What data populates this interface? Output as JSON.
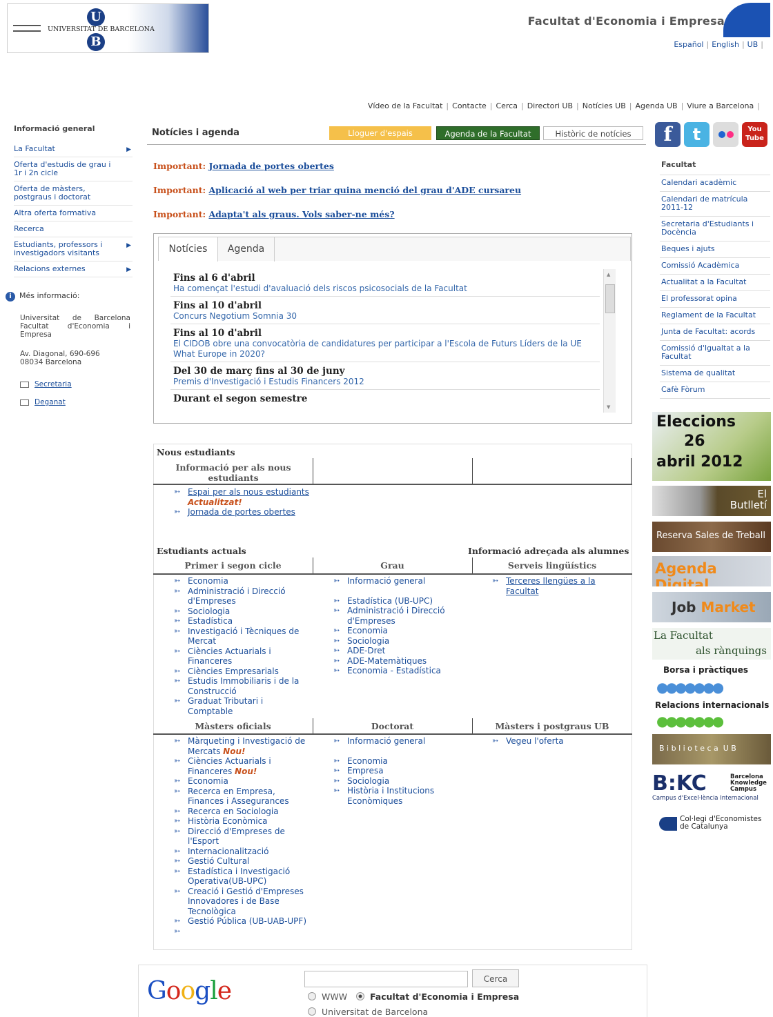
{
  "header": {
    "university": "UNIVERSITAT DE BARCELONA",
    "faculty_title": "Facultat d'Economia i Empresa",
    "languages": [
      "Español",
      "English",
      "UB"
    ],
    "topnav": [
      "Vídeo de la Facultat",
      "Contacte",
      "Cerca",
      "Directori UB",
      "Notícies UB",
      "Agenda UB",
      "Viure a Barcelona"
    ]
  },
  "left": {
    "title": "Informació general",
    "items": [
      {
        "label": "La Facultat",
        "arrow": true
      },
      {
        "label": "Oferta d'estudis de grau i 1r i 2n cicle",
        "arrow": false
      },
      {
        "label": "Oferta de màsters, postgraus i doctorat",
        "arrow": false
      },
      {
        "label": "Altra oferta formativa",
        "arrow": false
      },
      {
        "label": "Recerca",
        "arrow": false
      },
      {
        "label": "Estudiants, professors i investigadors visitants",
        "arrow": true
      },
      {
        "label": "Relacions externes",
        "arrow": true
      }
    ],
    "mes_info": "Més informació:",
    "address_1": "Universitat de Barcelona Facultat d'Economia i Empresa",
    "address_2": "Av. Diagonal, 690-696 08034 Barcelona",
    "mail_1": "Secretaria",
    "mail_2": "Deganat"
  },
  "center": {
    "title": "Notícies i agenda",
    "btn_lloguer": "Lloguer d'espais",
    "btn_agenda": "Agenda de la Facultat",
    "btn_historic": "Històric de notícies",
    "important_label": "Important:",
    "important": [
      "Jornada de portes obertes",
      "Aplicació al web per triar quina menció del grau d'ADE cursareu",
      "Adapta't als graus. Vols saber-ne més?"
    ],
    "tabs": [
      "Notícies",
      "Agenda"
    ],
    "news": [
      {
        "title": "Fins al 6 d'abril",
        "text": "Ha començat l'estudi d'avaluació dels riscos psicosocials de la Facultat"
      },
      {
        "title": "Fins al 10 d'abril",
        "text": "Concurs Negotium Somnia 30"
      },
      {
        "title": "Fins al 10 d'abril",
        "text": "El CIDOB obre una convocatòria de candidatures per participar a l'Escola de Futurs Líders de la UE What Europe in 2020?"
      },
      {
        "title": "Del 30 de març fins al 30 de juny",
        "text": "Premis d'Investigació i Estudis Financers 2012"
      },
      {
        "title": "Durant el segon semestre",
        "text": ""
      }
    ]
  },
  "students": {
    "nous_title": "Nous estudiants",
    "nous_col": "Informació per als nous estudiants",
    "nous_links": [
      "Espai per als nous estudiants",
      "Jornada de portes obertes"
    ],
    "actualitzat": "Actualitzat!",
    "actuals_title": "Estudiants actuals",
    "alumnes_title": "Informació adreçada als alumnes",
    "col_primer": "Primer i segon cicle",
    "col_grau": "Grau",
    "col_serveis": "Serveis lingüístics",
    "primer_links": [
      "Economia",
      "Administració i Direcció d'Empreses",
      "Sociologia",
      "Estadística",
      "Investigació i Tècniques de Mercat",
      "Ciències Actuarials i Financeres",
      "Ciències Empresarials",
      "Estudis Immobiliaris i de la Construcció",
      "Graduat Tributari i Comptable"
    ],
    "grau_links": [
      "Informació general",
      "Estadística (UB-UPC)",
      "Administració i Direcció d'Empreses",
      "Economia",
      "Sociologia",
      "ADE-Dret",
      "ADE-Matemàtiques",
      "Economia - Estadística"
    ],
    "serveis_links": [
      "Terceres llengües a la Facultat"
    ],
    "col_masters": "Màsters oficials",
    "col_doctorat": "Doctorat",
    "col_mpg": "Màsters i postgraus UB",
    "masters_links": [
      "Màrqueting i Investigació de Mercats",
      "Ciències Actuarials i Financeres",
      "Economia",
      "Recerca en Empresa, Finances i Assegurances",
      "Recerca en Sociologia",
      "Història Econòmica",
      "Direcció d'Empreses de l'Esport",
      "Internacionalització",
      "Gestió Cultural",
      "Estadística i Investigació Operativa(UB-UPC)",
      "Creació i Gestió d'Empreses Innovadores i de Base Tecnològica",
      "Gestió Pública (UB-UAB-UPF)"
    ],
    "nou": "Nou!",
    "doctorat_links": [
      "Informació general",
      "Economia",
      "Empresa",
      "Sociologia",
      "Història i Institucions Econòmiques"
    ],
    "mpg_links": [
      "Vegeu l'oferta"
    ]
  },
  "right": {
    "social": [
      "facebook-icon",
      "twitter-icon",
      "flickr-icon",
      "youtube-icon"
    ],
    "youtube_text": "You Tube",
    "title": "Facultat",
    "items": [
      "Calendari acadèmic",
      "Calendari de matrícula 2011-12",
      "Secretaria d'Estudiants i Docència",
      "Beques i ajuts",
      "Comissió Acadèmica",
      "Actualitat a la Facultat",
      "El professorat opina",
      "Reglament de la Facultat",
      "Junta de Facultat: acords",
      "Comissió d'Igualtat a la Facultat",
      "Sistema de qualitat",
      "Cafè Fòrum"
    ],
    "banners": {
      "eleccions_1": "Eleccions",
      "eleccions_2": "26",
      "eleccions_3": "abril 2012",
      "butlleti_1": "El",
      "butlleti_2": "Butlletí",
      "reserva": "Reserva Sales de Treball",
      "agenda_digital": "Agenda Digital",
      "job_1": "Job",
      "job_2": "Market",
      "rank_1": "La Facultat",
      "rank_2": "als rànquings",
      "borsa": "Borsa i pràctiques",
      "relacions": "Relacions internacionals",
      "biblioteca": "B i b l i o t e c a  U B",
      "bkc_logo": "B:KC",
      "bkc_name": "Barcelona Knowledge Campus",
      "bkc_sub": "Campus d'Excel·lència Internacional",
      "col_legi": "Col·legi d'Economistes de Catalunya"
    }
  },
  "google": {
    "logo": "Google",
    "button": "Cerca",
    "opt_www": "WWW",
    "opt_fac": "Facultat d'Economia i Empresa",
    "opt_ub": "Universitat de Barcelona"
  }
}
